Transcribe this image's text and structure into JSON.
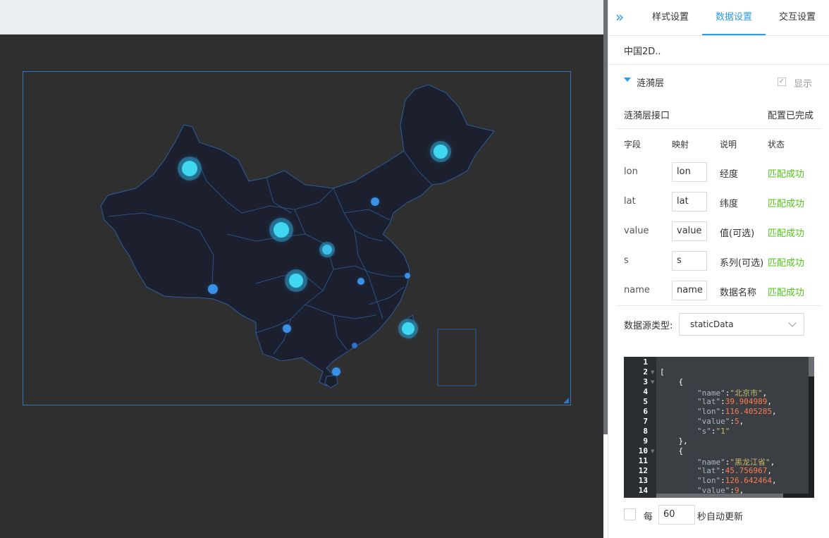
{
  "tabs": [
    {
      "label": "样式设置",
      "active": false
    },
    {
      "label": "数据设置",
      "active": true
    },
    {
      "label": "交互设置",
      "active": false
    }
  ],
  "component_name": "中国2D..",
  "layer": {
    "title": "涟漪层",
    "show_label": "显示",
    "show_checked": true
  },
  "api": {
    "label": "涟漪层接口",
    "status": "配置已完成"
  },
  "field_table": {
    "headers": [
      "字段",
      "映射",
      "说明",
      "状态"
    ],
    "rows": [
      {
        "field": "lon",
        "mapping": "lon",
        "desc": "经度",
        "status": "匹配成功"
      },
      {
        "field": "lat",
        "mapping": "lat",
        "desc": "纬度",
        "status": "匹配成功"
      },
      {
        "field": "value",
        "mapping": "value",
        "desc": "值(可选)",
        "status": "匹配成功"
      },
      {
        "field": "s",
        "mapping": "s",
        "desc": "系列(可选)",
        "status": "匹配成功"
      },
      {
        "field": "name",
        "mapping": "name",
        "desc": "数据名称",
        "status": "匹配成功"
      }
    ]
  },
  "source": {
    "label": "数据源类型:",
    "value": "staticData"
  },
  "code_lines": [
    {
      "n": "1",
      "t": ""
    },
    {
      "n": "2",
      "t": "["
    },
    {
      "n": "3",
      "t": "    {"
    },
    {
      "n": "4",
      "key": "\"name\"",
      "val": "\"北京市\"",
      "kind": "s"
    },
    {
      "n": "5",
      "key": "\"lat\"",
      "val": "39.904989",
      "kind": "n"
    },
    {
      "n": "6",
      "key": "\"lon\"",
      "val": "116.405285",
      "kind": "n"
    },
    {
      "n": "7",
      "key": "\"value\"",
      "val": "5",
      "kind": "n"
    },
    {
      "n": "8",
      "key": "\"s\"",
      "val": "\"1\"",
      "kind": "s",
      "last": true
    },
    {
      "n": "9",
      "t": "    },"
    },
    {
      "n": "10",
      "t": "    {"
    },
    {
      "n": "11",
      "key": "\"name\"",
      "val": "\"黑龙江省\"",
      "kind": "s"
    },
    {
      "n": "12",
      "key": "\"lat\"",
      "val": "45.756967",
      "kind": "n"
    },
    {
      "n": "13",
      "key": "\"lon\"",
      "val": "126.642464",
      "kind": "n"
    },
    {
      "n": "14",
      "key": "\"value\"",
      "val": "9",
      "kind": "n"
    }
  ],
  "auto_update": {
    "prefix": "每",
    "interval": "60",
    "suffix": "秒自动更新",
    "checked": false
  },
  "colors": {
    "accent": "#2d9be8",
    "success": "#52c41a",
    "map_fill": "#1b1f2e",
    "map_border": "#2a5f9e",
    "ripple": "#3fd8f0"
  },
  "icons": {
    "collapse": "double-chevron-right-icon",
    "layer_toggle": "caret-down-icon",
    "select": "chevron-down-icon"
  }
}
